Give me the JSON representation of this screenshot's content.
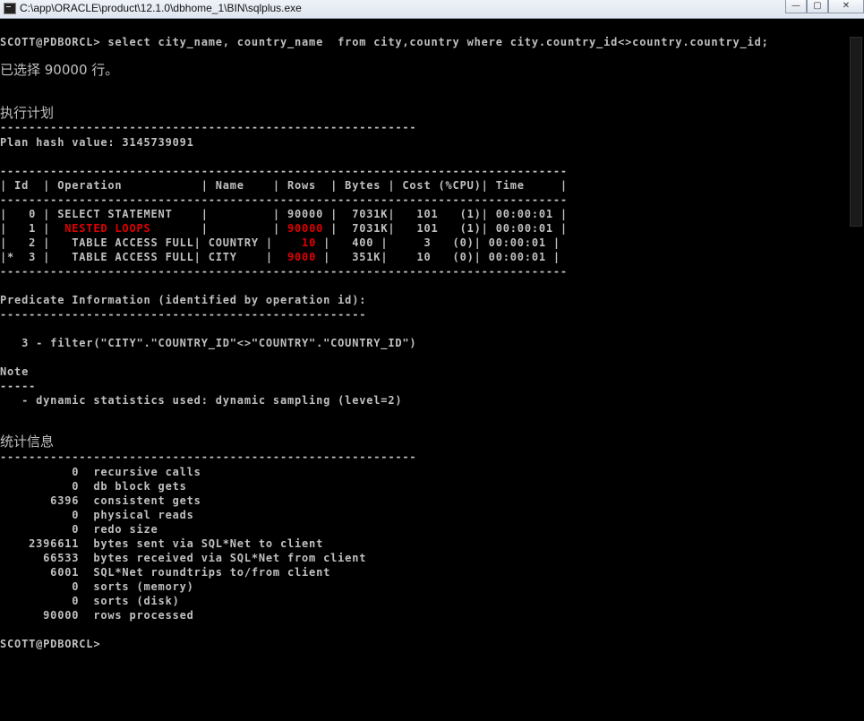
{
  "window": {
    "title": "C:\\app\\ORACLE\\product\\12.1.0\\dbhome_1\\BIN\\sqlplus.exe",
    "buttons": {
      "minimize": "—",
      "maximize": "▢",
      "close": "✕"
    }
  },
  "colors": {
    "highlight": "#e00000",
    "text": "#c0c0c0",
    "background": "#000000"
  },
  "console": {
    "command": "SCOTT@PDBORCL> select city_name, country_name  from city,country where city.country_id<>country.country_id;",
    "rows_selected": "已选择 90000 行。",
    "plan_heading": "执行计划",
    "plan_rule": "----------------------------------------------------------",
    "plan_hash": "Plan hash value: 3145739091",
    "table_rule": "-------------------------------------------------------------------------------",
    "table_header": "| Id  | Operation           | Name    | Rows  | Bytes | Cost (%CPU)| Time     |",
    "plan_rows": [
      {
        "prefix": "|   0 | SELECT STATEMENT    |         | ",
        "op_red": "",
        "rows": "90000",
        "suffix": " |  7031K|   101   (1)| 00:00:01 |",
        "red_op": false,
        "red_rows": false
      },
      {
        "prefix": "|   1 | ",
        "op_red": " NESTED LOOPS",
        "op_pad": "       |         | ",
        "rows": "90000",
        "suffix": " |  7031K|   101   (1)| 00:00:01 |",
        "red_op": true,
        "red_rows": true
      },
      {
        "prefix": "|   2 |   TABLE ACCESS FULL| COUNTRY | ",
        "op_red": "",
        "rows": "   10",
        "suffix": " |   400 |     3   (0)| 00:00:01 |",
        "red_op": false,
        "red_rows": true
      },
      {
        "prefix": "|*  3 |   TABLE ACCESS FULL| CITY    | ",
        "op_red": "",
        "rows": " 9000",
        "suffix": " |   351K|    10   (0)| 00:00:01 |",
        "red_op": false,
        "red_rows": true
      }
    ],
    "predicate_heading": "Predicate Information (identified by operation id):",
    "predicate_rule": "---------------------------------------------------",
    "predicate_filter": "   3 - filter(\"CITY\".\"COUNTRY_ID\"<>\"COUNTRY\".\"COUNTRY_ID\")",
    "note_heading": "Note",
    "note_rule": "-----",
    "note_text": "   - dynamic statistics used: dynamic sampling (level=2)",
    "stats_heading": "统计信息",
    "stats_rule": "----------------------------------------------------------",
    "stats": [
      "          0  recursive calls",
      "          0  db block gets",
      "       6396  consistent gets",
      "          0  physical reads",
      "          0  redo size",
      "    2396611  bytes sent via SQL*Net to client",
      "      66533  bytes received via SQL*Net from client",
      "       6001  SQL*Net roundtrips to/from client",
      "          0  sorts (memory)",
      "          0  sorts (disk)",
      "      90000  rows processed"
    ],
    "prompt": "SCOTT@PDBORCL>"
  }
}
